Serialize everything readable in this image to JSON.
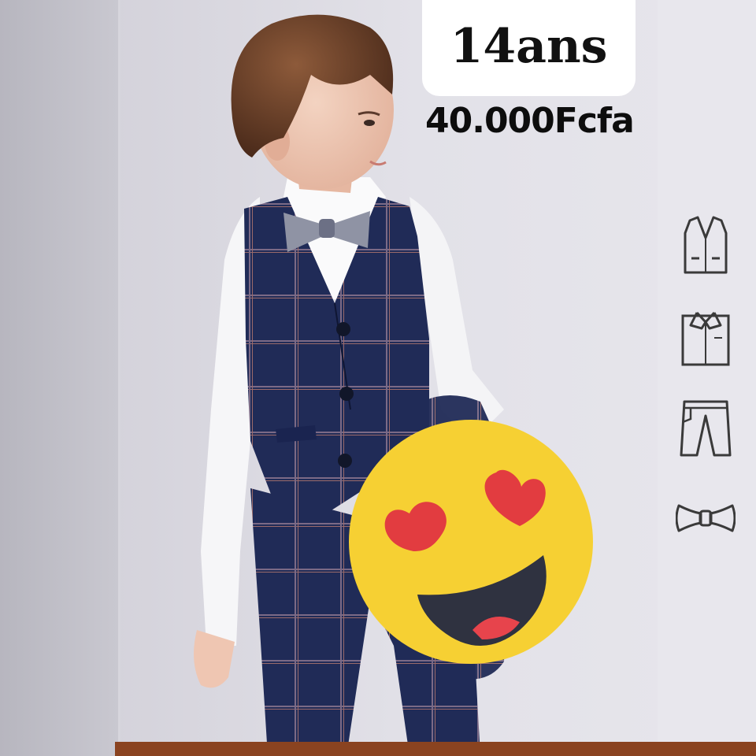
{
  "badge": {
    "age": "14ans"
  },
  "price": {
    "text": "40.000Fcfa"
  },
  "icons": [
    "vest-icon",
    "shirt-icon",
    "trousers-icon",
    "bow-tie-icon"
  ],
  "photo": {
    "subject": "boy-in-plaid-vest-suit",
    "emoji": "heart-eyes-emoji"
  },
  "colors": {
    "suit": "#1f2a55",
    "shirt": "#f7f7f8",
    "emoji": "#f6d033",
    "heart": "#e23c40",
    "accent_strip": "#8a4320"
  }
}
